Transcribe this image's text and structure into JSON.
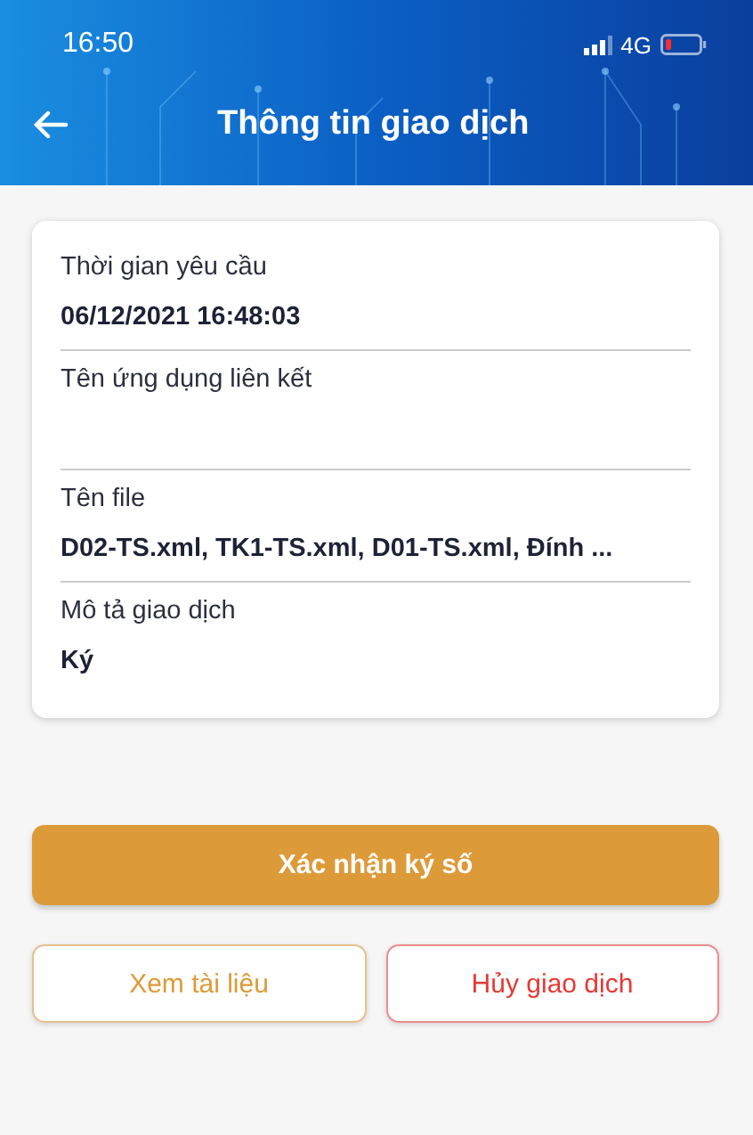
{
  "status_bar": {
    "time": "16:50",
    "network": "4G"
  },
  "header": {
    "title": "Thông tin giao dịch"
  },
  "fields": [
    {
      "label": "Thời gian yêu cầu",
      "value": "06/12/2021 16:48:03"
    },
    {
      "label": "Tên ứng dụng liên kết"
    },
    {
      "label": "Tên file",
      "value": "D02-TS.xml, TK1-TS.xml, D01-TS.xml, Đính ..."
    },
    {
      "label": "Mô tả giao dịch",
      "value": "Ký"
    }
  ],
  "primary_button": {
    "label": "Xác nhận ký số"
  },
  "buttons": [
    {
      "label": "Xem tài liệu",
      "kind": "warning"
    },
    {
      "label": "Hủy giao dịch",
      "kind": "danger"
    }
  ]
}
